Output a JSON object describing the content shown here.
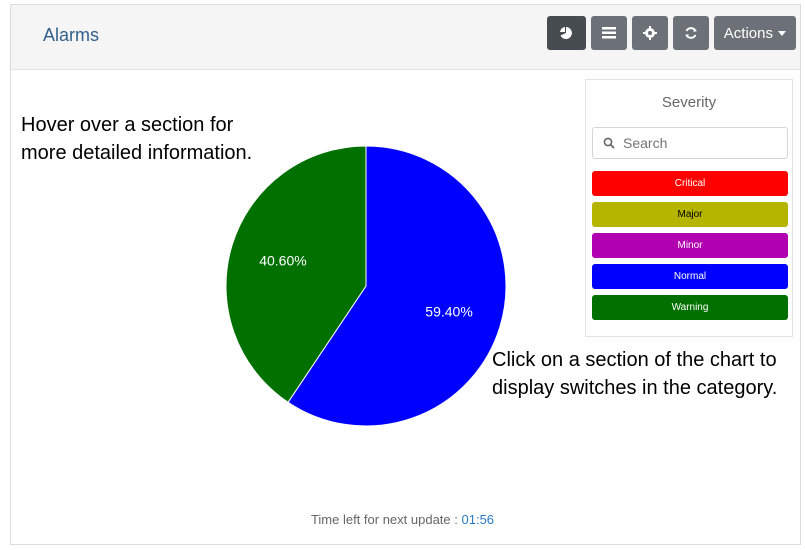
{
  "header": {
    "title": "Alarms",
    "actions_label": "Actions"
  },
  "toolbar_icons": [
    "pie-chart-icon",
    "list-icon",
    "gear-icon",
    "refresh-icon"
  ],
  "hints": {
    "left": "Hover over a section for more detailed information.",
    "right": "Click on a section of the chart to display switches in the category."
  },
  "legend": {
    "title": "Severity",
    "search_placeholder": "Search",
    "items": [
      {
        "label": "Critical",
        "color": "#ff0000",
        "text_color": "#ffffff"
      },
      {
        "label": "Major",
        "color": "#b5b500",
        "text_color": "#000000"
      },
      {
        "label": "Minor",
        "color": "#b000b0",
        "text_color": "#ffffff"
      },
      {
        "label": "Normal",
        "color": "#0000ff",
        "text_color": "#ffffff"
      },
      {
        "label": "Warning",
        "color": "#007000",
        "text_color": "#ffffff"
      }
    ]
  },
  "chart_data": {
    "type": "pie",
    "slices": [
      {
        "label": "59.40%",
        "value": 59.4,
        "color": "#0000ff"
      },
      {
        "label": "40.60%",
        "value": 40.6,
        "color": "#007000"
      }
    ]
  },
  "footer": {
    "label": "Time left for next update :",
    "timer": "01:56"
  }
}
